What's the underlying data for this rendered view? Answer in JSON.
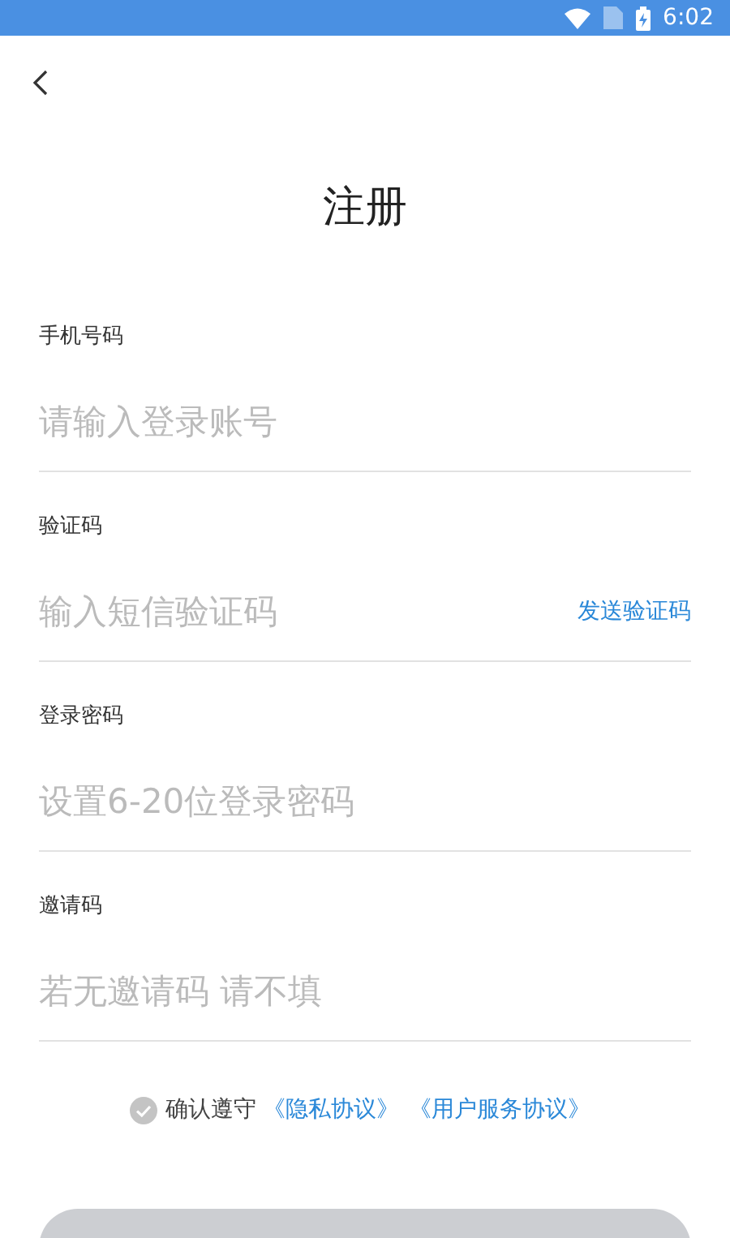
{
  "status_bar": {
    "time": "6:02"
  },
  "title": "注册",
  "fields": [
    {
      "label": "手机号码",
      "placeholder": "请输入登录账号"
    },
    {
      "label": "验证码",
      "placeholder": "输入短信验证码",
      "action": "发送验证码"
    },
    {
      "label": "登录密码",
      "placeholder": "设置6-20位登录密码"
    },
    {
      "label": "邀请码",
      "placeholder": "若无邀请码 请不填"
    }
  ],
  "agreement": {
    "checked": false,
    "text": "确认遵守",
    "links": [
      "《隐私协议》",
      "《用户服务协议》"
    ]
  },
  "submit": {
    "disabled": true
  }
}
